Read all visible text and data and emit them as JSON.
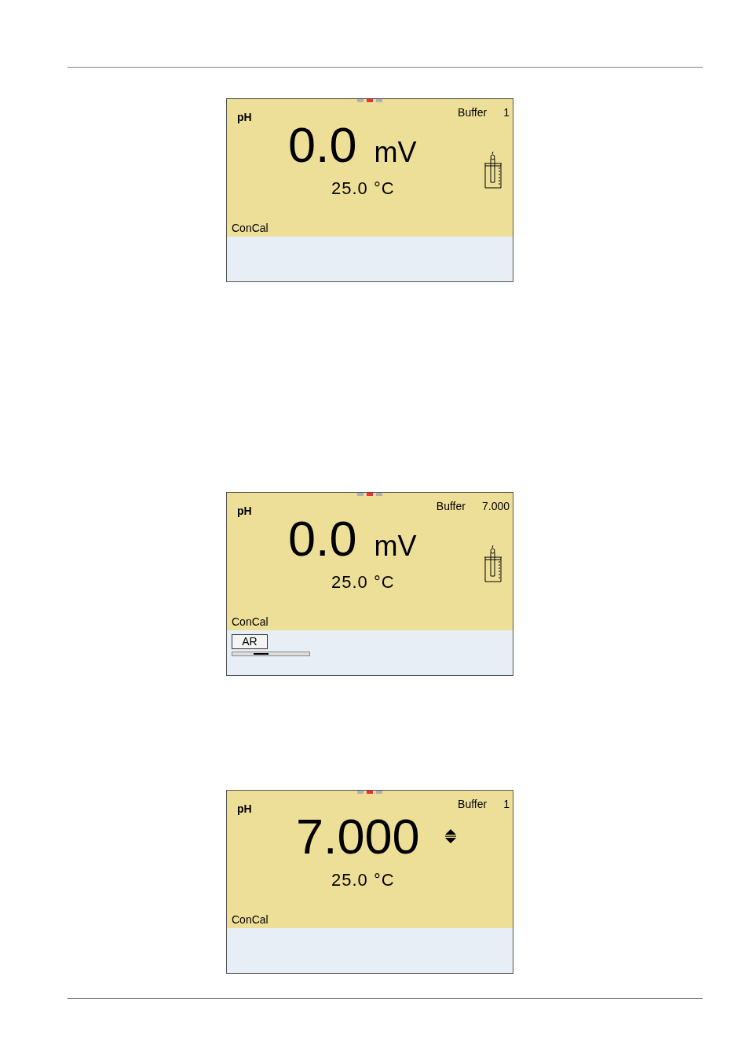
{
  "screens": [
    {
      "indicator": [
        {
          "selected": false
        },
        {
          "selected": true
        },
        {
          "selected": false
        }
      ],
      "channel": "pH",
      "buffer_label": "Buffer",
      "buffer_value": "1",
      "reading": "0.0",
      "unit": "mV",
      "temperature": "25.0 °C",
      "mode": "ConCal",
      "side_icon": {
        "kind": "electrode"
      }
    },
    {
      "indicator": [
        {
          "selected": false
        },
        {
          "selected": true
        },
        {
          "selected": false
        }
      ],
      "channel": "pH",
      "buffer_label": "Buffer",
      "buffer_value": "7.000",
      "reading": "0.0",
      "unit": "mV",
      "temperature": "25.0 °C",
      "mode": "ConCal",
      "side_icon": {
        "kind": "electrode"
      },
      "stability": {
        "label": "AR"
      }
    },
    {
      "indicator": [
        {
          "selected": false
        },
        {
          "selected": true
        },
        {
          "selected": false
        }
      ],
      "channel": "pH",
      "buffer_label": "Buffer",
      "buffer_value": "1",
      "reading": "7.000",
      "temperature": "25.0 °C",
      "mode": "ConCal",
      "side_icon": {
        "kind": "updown"
      }
    }
  ]
}
